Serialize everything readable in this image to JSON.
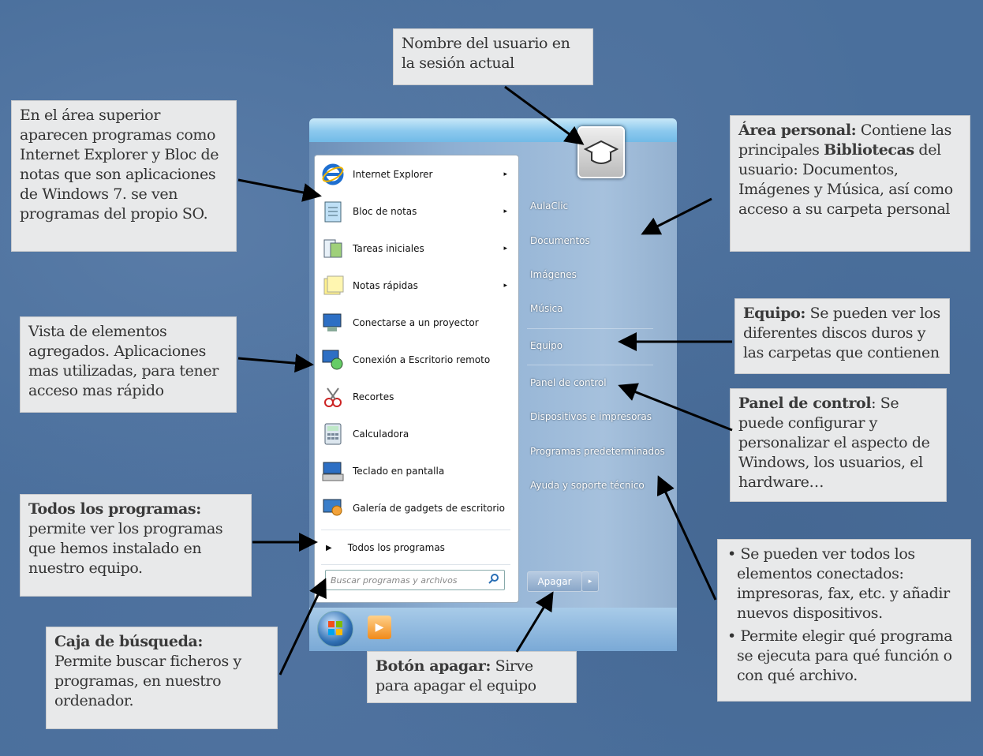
{
  "callouts": {
    "usuario": {
      "text": "Nombre del usuario en la sesión actual"
    },
    "superior": {
      "text": "En el área superior aparecen programas como Internet Explorer y Bloc de notas que son aplicaciones de Windows 7. se ven programas del propio SO."
    },
    "personal": {
      "title": "Área personal:",
      "text1": " Contiene las principales ",
      "bold2": "Bibliotecas",
      "text2": " del usuario: Documentos, Imágenes y Música, así como acceso a su carpeta personal"
    },
    "vista": {
      "text": "Vista de elementos agregados. Aplicaciones mas utilizadas, para tener acceso mas rápido"
    },
    "equipo": {
      "title": "Equipo:",
      "text": " Se pueden ver los diferentes discos duros y las carpetas que contienen"
    },
    "panel": {
      "title": "Panel de control",
      "text": ": Se puede configurar y personalizar el aspecto de Windows, los usuarios, el hardware…"
    },
    "todos": {
      "title": "Todos los programas:",
      "text": "permite ver los programas que hemos instalado en nuestro equipo."
    },
    "dispositivos": {
      "bullet1": "Se pueden ver todos los elementos conectados: impresoras, fax, etc. y añadir nuevos dispositivos.",
      "bullet2": "Permite elegir qué programa se ejecuta para qué función o con qué archivo."
    },
    "busqueda": {
      "title": "Caja de búsqueda:",
      "text": "Permite buscar ficheros y programas, en nuestro ordenador."
    },
    "apagar": {
      "title": "Botón apagar:",
      "text": " Sirve para apagar el equipo"
    }
  },
  "start_menu": {
    "programs": [
      {
        "label": "Internet Explorer",
        "icon": "ie-icon",
        "has_arrow": true
      },
      {
        "label": "Bloc de notas",
        "icon": "notepad-icon",
        "has_arrow": true
      },
      {
        "label": "Tareas iniciales",
        "icon": "getting-started-icon",
        "has_arrow": true
      },
      {
        "label": "Notas rápidas",
        "icon": "sticky-notes-icon",
        "has_arrow": true
      },
      {
        "label": "Conectarse a un proyector",
        "icon": "projector-icon",
        "has_arrow": false
      },
      {
        "label": "Conexión a Escritorio remoto",
        "icon": "remote-desktop-icon",
        "has_arrow": false
      },
      {
        "label": "Recortes",
        "icon": "snipping-tool-icon",
        "has_arrow": false
      },
      {
        "label": "Calculadora",
        "icon": "calculator-icon",
        "has_arrow": false
      },
      {
        "label": "Teclado en pantalla",
        "icon": "keyboard-icon",
        "has_arrow": false
      },
      {
        "label": "Galería de gadgets de escritorio",
        "icon": "gadgets-icon",
        "has_arrow": false
      }
    ],
    "all_programs": "Todos los programas",
    "search_placeholder": "Buscar programas y archivos",
    "right_items": [
      "AulaClic",
      "Documentos",
      "Imágenes",
      "Música",
      "Equipo",
      "Panel de control",
      "Dispositivos e impresoras",
      "Programas predeterminados",
      "Ayuda y soporte técnico"
    ],
    "shutdown_label": "Apagar",
    "arrow_glyph": "▸"
  }
}
